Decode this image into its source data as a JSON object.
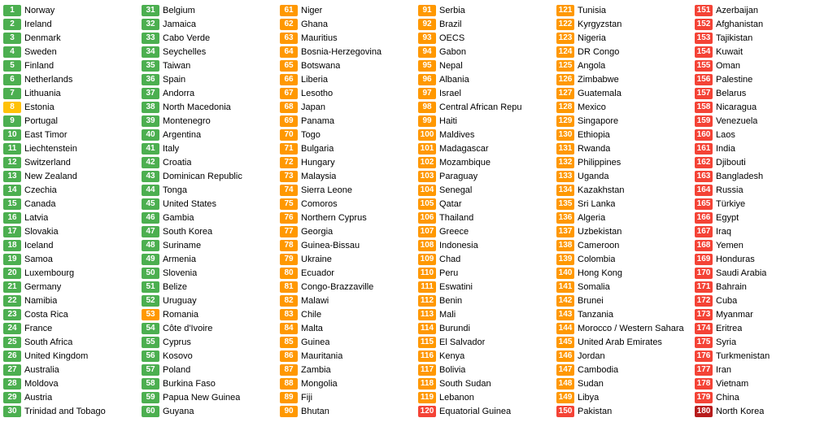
{
  "columns": [
    {
      "id": "col1",
      "entries": [
        {
          "rank": 1,
          "country": "Norway",
          "color": "green"
        },
        {
          "rank": 2,
          "country": "Ireland",
          "color": "green"
        },
        {
          "rank": 3,
          "country": "Denmark",
          "color": "green"
        },
        {
          "rank": 4,
          "country": "Sweden",
          "color": "green"
        },
        {
          "rank": 5,
          "country": "Finland",
          "color": "green"
        },
        {
          "rank": 6,
          "country": "Netherlands",
          "color": "green"
        },
        {
          "rank": 7,
          "country": "Lithuania",
          "color": "green"
        },
        {
          "rank": 8,
          "country": "Estonia",
          "color": "yellow"
        },
        {
          "rank": 9,
          "country": "Portugal",
          "color": "green"
        },
        {
          "rank": 10,
          "country": "East Timor",
          "color": "green"
        },
        {
          "rank": 11,
          "country": "Liechtenstein",
          "color": "green"
        },
        {
          "rank": 12,
          "country": "Switzerland",
          "color": "green"
        },
        {
          "rank": 13,
          "country": "New Zealand",
          "color": "green"
        },
        {
          "rank": 14,
          "country": "Czechia",
          "color": "green"
        },
        {
          "rank": 15,
          "country": "Canada",
          "color": "green"
        },
        {
          "rank": 16,
          "country": "Latvia",
          "color": "green"
        },
        {
          "rank": 17,
          "country": "Slovakia",
          "color": "green"
        },
        {
          "rank": 18,
          "country": "Iceland",
          "color": "green"
        },
        {
          "rank": 19,
          "country": "Samoa",
          "color": "green"
        },
        {
          "rank": 20,
          "country": "Luxembourg",
          "color": "green"
        },
        {
          "rank": 21,
          "country": "Germany",
          "color": "green"
        },
        {
          "rank": 22,
          "country": "Namibia",
          "color": "green"
        },
        {
          "rank": 23,
          "country": "Costa Rica",
          "color": "green"
        },
        {
          "rank": 24,
          "country": "France",
          "color": "green"
        },
        {
          "rank": 25,
          "country": "South Africa",
          "color": "green"
        },
        {
          "rank": 26,
          "country": "United Kingdom",
          "color": "green"
        },
        {
          "rank": 27,
          "country": "Australia",
          "color": "green"
        },
        {
          "rank": 28,
          "country": "Moldova",
          "color": "green"
        },
        {
          "rank": 29,
          "country": "Austria",
          "color": "green"
        },
        {
          "rank": 30,
          "country": "Trinidad and Tobago",
          "color": "green"
        }
      ]
    },
    {
      "id": "col2",
      "entries": [
        {
          "rank": 31,
          "country": "Belgium",
          "color": "green"
        },
        {
          "rank": 32,
          "country": "Jamaica",
          "color": "green"
        },
        {
          "rank": 33,
          "country": "Cabo Verde",
          "color": "green"
        },
        {
          "rank": 34,
          "country": "Seychelles",
          "color": "green"
        },
        {
          "rank": 35,
          "country": "Taiwan",
          "color": "green"
        },
        {
          "rank": 36,
          "country": "Spain",
          "color": "green"
        },
        {
          "rank": 37,
          "country": "Andorra",
          "color": "green"
        },
        {
          "rank": 38,
          "country": "North Macedonia",
          "color": "green"
        },
        {
          "rank": 39,
          "country": "Montenegro",
          "color": "green"
        },
        {
          "rank": 40,
          "country": "Argentina",
          "color": "green"
        },
        {
          "rank": 41,
          "country": "Italy",
          "color": "green"
        },
        {
          "rank": 42,
          "country": "Croatia",
          "color": "green"
        },
        {
          "rank": 43,
          "country": "Dominican Republic",
          "color": "green"
        },
        {
          "rank": 44,
          "country": "Tonga",
          "color": "green"
        },
        {
          "rank": 45,
          "country": "United States",
          "color": "green"
        },
        {
          "rank": 46,
          "country": "Gambia",
          "color": "green"
        },
        {
          "rank": 47,
          "country": "South Korea",
          "color": "green"
        },
        {
          "rank": 48,
          "country": "Suriname",
          "color": "green"
        },
        {
          "rank": 49,
          "country": "Armenia",
          "color": "green"
        },
        {
          "rank": 50,
          "country": "Slovenia",
          "color": "green"
        },
        {
          "rank": 51,
          "country": "Belize",
          "color": "green"
        },
        {
          "rank": 52,
          "country": "Uruguay",
          "color": "green"
        },
        {
          "rank": 53,
          "country": "Romania",
          "color": "orange"
        },
        {
          "rank": 54,
          "country": "Côte d'Ivoire",
          "color": "green"
        },
        {
          "rank": 55,
          "country": "Cyprus",
          "color": "green"
        },
        {
          "rank": 56,
          "country": "Kosovo",
          "color": "green"
        },
        {
          "rank": 57,
          "country": "Poland",
          "color": "green"
        },
        {
          "rank": 58,
          "country": "Burkina Faso",
          "color": "green"
        },
        {
          "rank": 59,
          "country": "Papua New Guinea",
          "color": "green"
        },
        {
          "rank": 60,
          "country": "Guyana",
          "color": "green"
        }
      ]
    },
    {
      "id": "col3",
      "entries": [
        {
          "rank": 61,
          "country": "Niger",
          "color": "orange"
        },
        {
          "rank": 62,
          "country": "Ghana",
          "color": "orange"
        },
        {
          "rank": 63,
          "country": "Mauritius",
          "color": "orange"
        },
        {
          "rank": 64,
          "country": "Bosnia-Herzegovina",
          "color": "orange"
        },
        {
          "rank": 65,
          "country": "Botswana",
          "color": "orange"
        },
        {
          "rank": 66,
          "country": "Liberia",
          "color": "orange"
        },
        {
          "rank": 67,
          "country": "Lesotho",
          "color": "orange"
        },
        {
          "rank": 68,
          "country": "Japan",
          "color": "orange"
        },
        {
          "rank": 69,
          "country": "Panama",
          "color": "orange"
        },
        {
          "rank": 70,
          "country": "Togo",
          "color": "orange"
        },
        {
          "rank": 71,
          "country": "Bulgaria",
          "color": "orange"
        },
        {
          "rank": 72,
          "country": "Hungary",
          "color": "orange"
        },
        {
          "rank": 73,
          "country": "Malaysia",
          "color": "orange"
        },
        {
          "rank": 74,
          "country": "Sierra Leone",
          "color": "orange"
        },
        {
          "rank": 75,
          "country": "Comoros",
          "color": "orange"
        },
        {
          "rank": 76,
          "country": "Northern Cyprus",
          "color": "orange"
        },
        {
          "rank": 77,
          "country": "Georgia",
          "color": "orange"
        },
        {
          "rank": 78,
          "country": "Guinea-Bissau",
          "color": "orange"
        },
        {
          "rank": 79,
          "country": "Ukraine",
          "color": "orange"
        },
        {
          "rank": 80,
          "country": "Ecuador",
          "color": "orange"
        },
        {
          "rank": 81,
          "country": "Congo-Brazzaville",
          "color": "orange"
        },
        {
          "rank": 82,
          "country": "Malawi",
          "color": "orange"
        },
        {
          "rank": 83,
          "country": "Chile",
          "color": "orange"
        },
        {
          "rank": 84,
          "country": "Malta",
          "color": "orange"
        },
        {
          "rank": 85,
          "country": "Guinea",
          "color": "orange"
        },
        {
          "rank": 86,
          "country": "Mauritania",
          "color": "orange"
        },
        {
          "rank": 87,
          "country": "Zambia",
          "color": "orange"
        },
        {
          "rank": 88,
          "country": "Mongolia",
          "color": "orange"
        },
        {
          "rank": 89,
          "country": "Fiji",
          "color": "orange"
        },
        {
          "rank": 90,
          "country": "Bhutan",
          "color": "orange"
        }
      ]
    },
    {
      "id": "col4",
      "entries": [
        {
          "rank": 91,
          "country": "Serbia",
          "color": "orange"
        },
        {
          "rank": 92,
          "country": "Brazil",
          "color": "orange"
        },
        {
          "rank": 93,
          "country": "OECS",
          "color": "orange"
        },
        {
          "rank": 94,
          "country": "Gabon",
          "color": "orange"
        },
        {
          "rank": 95,
          "country": "Nepal",
          "color": "orange"
        },
        {
          "rank": 96,
          "country": "Albania",
          "color": "orange"
        },
        {
          "rank": 97,
          "country": "Israel",
          "color": "orange"
        },
        {
          "rank": 98,
          "country": "Central African Repu",
          "color": "orange"
        },
        {
          "rank": 99,
          "country": "Haiti",
          "color": "orange"
        },
        {
          "rank": 100,
          "country": "Maldives",
          "color": "orange"
        },
        {
          "rank": 101,
          "country": "Madagascar",
          "color": "orange"
        },
        {
          "rank": 102,
          "country": "Mozambique",
          "color": "orange"
        },
        {
          "rank": 103,
          "country": "Paraguay",
          "color": "orange"
        },
        {
          "rank": 104,
          "country": "Senegal",
          "color": "orange"
        },
        {
          "rank": 105,
          "country": "Qatar",
          "color": "orange"
        },
        {
          "rank": 106,
          "country": "Thailand",
          "color": "orange"
        },
        {
          "rank": 107,
          "country": "Greece",
          "color": "orange"
        },
        {
          "rank": 108,
          "country": "Indonesia",
          "color": "orange"
        },
        {
          "rank": 109,
          "country": "Chad",
          "color": "orange"
        },
        {
          "rank": 110,
          "country": "Peru",
          "color": "orange"
        },
        {
          "rank": 111,
          "country": "Eswatini",
          "color": "orange"
        },
        {
          "rank": 112,
          "country": "Benin",
          "color": "orange"
        },
        {
          "rank": 113,
          "country": "Mali",
          "color": "orange"
        },
        {
          "rank": 114,
          "country": "Burundi",
          "color": "orange"
        },
        {
          "rank": 115,
          "country": "El Salvador",
          "color": "orange"
        },
        {
          "rank": 116,
          "country": "Kenya",
          "color": "orange"
        },
        {
          "rank": 117,
          "country": "Bolivia",
          "color": "orange"
        },
        {
          "rank": 118,
          "country": "South Sudan",
          "color": "orange"
        },
        {
          "rank": 119,
          "country": "Lebanon",
          "color": "orange"
        },
        {
          "rank": 120,
          "country": "Equatorial Guinea",
          "color": "red"
        }
      ]
    },
    {
      "id": "col5",
      "entries": [
        {
          "rank": 121,
          "country": "Tunisia",
          "color": "orange"
        },
        {
          "rank": 122,
          "country": "Kyrgyzstan",
          "color": "orange"
        },
        {
          "rank": 123,
          "country": "Nigeria",
          "color": "orange"
        },
        {
          "rank": 124,
          "country": "DR Congo",
          "color": "orange"
        },
        {
          "rank": 125,
          "country": "Angola",
          "color": "orange"
        },
        {
          "rank": 126,
          "country": "Zimbabwe",
          "color": "orange"
        },
        {
          "rank": 127,
          "country": "Guatemala",
          "color": "orange"
        },
        {
          "rank": 128,
          "country": "Mexico",
          "color": "orange"
        },
        {
          "rank": 129,
          "country": "Singapore",
          "color": "orange"
        },
        {
          "rank": 130,
          "country": "Ethiopia",
          "color": "orange"
        },
        {
          "rank": 131,
          "country": "Rwanda",
          "color": "orange"
        },
        {
          "rank": 132,
          "country": "Philippines",
          "color": "orange"
        },
        {
          "rank": 133,
          "country": "Uganda",
          "color": "orange"
        },
        {
          "rank": 134,
          "country": "Kazakhstan",
          "color": "orange"
        },
        {
          "rank": 135,
          "country": "Sri Lanka",
          "color": "orange"
        },
        {
          "rank": 136,
          "country": "Algeria",
          "color": "orange"
        },
        {
          "rank": 137,
          "country": "Uzbekistan",
          "color": "orange"
        },
        {
          "rank": 138,
          "country": "Cameroon",
          "color": "orange"
        },
        {
          "rank": 139,
          "country": "Colombia",
          "color": "orange"
        },
        {
          "rank": 140,
          "country": "Hong Kong",
          "color": "orange"
        },
        {
          "rank": 141,
          "country": "Somalia",
          "color": "orange"
        },
        {
          "rank": 142,
          "country": "Brunei",
          "color": "orange"
        },
        {
          "rank": 143,
          "country": "Tanzania",
          "color": "orange"
        },
        {
          "rank": 144,
          "country": "Morocco / Western Sahara",
          "color": "orange"
        },
        {
          "rank": 145,
          "country": "United Arab Emirates",
          "color": "orange"
        },
        {
          "rank": 146,
          "country": "Jordan",
          "color": "orange"
        },
        {
          "rank": 147,
          "country": "Cambodia",
          "color": "orange"
        },
        {
          "rank": 148,
          "country": "Sudan",
          "color": "orange"
        },
        {
          "rank": 149,
          "country": "Libya",
          "color": "orange"
        },
        {
          "rank": 150,
          "country": "Pakistan",
          "color": "red"
        }
      ]
    },
    {
      "id": "col6",
      "entries": [
        {
          "rank": 151,
          "country": "Azerbaijan",
          "color": "red"
        },
        {
          "rank": 152,
          "country": "Afghanistan",
          "color": "red"
        },
        {
          "rank": 153,
          "country": "Tajikistan",
          "color": "red"
        },
        {
          "rank": 154,
          "country": "Kuwait",
          "color": "red"
        },
        {
          "rank": 155,
          "country": "Oman",
          "color": "red"
        },
        {
          "rank": 156,
          "country": "Palestine",
          "color": "red"
        },
        {
          "rank": 157,
          "country": "Belarus",
          "color": "red"
        },
        {
          "rank": 158,
          "country": "Nicaragua",
          "color": "red"
        },
        {
          "rank": 159,
          "country": "Venezuela",
          "color": "red"
        },
        {
          "rank": 160,
          "country": "Laos",
          "color": "red"
        },
        {
          "rank": 161,
          "country": "India",
          "color": "red"
        },
        {
          "rank": 162,
          "country": "Djibouti",
          "color": "red"
        },
        {
          "rank": 163,
          "country": "Bangladesh",
          "color": "red"
        },
        {
          "rank": 164,
          "country": "Russia",
          "color": "red"
        },
        {
          "rank": 165,
          "country": "Türkiye",
          "color": "red"
        },
        {
          "rank": 166,
          "country": "Egypt",
          "color": "red"
        },
        {
          "rank": 167,
          "country": "Iraq",
          "color": "red"
        },
        {
          "rank": 168,
          "country": "Yemen",
          "color": "red"
        },
        {
          "rank": 169,
          "country": "Honduras",
          "color": "red"
        },
        {
          "rank": 170,
          "country": "Saudi Arabia",
          "color": "red"
        },
        {
          "rank": 171,
          "country": "Bahrain",
          "color": "red"
        },
        {
          "rank": 172,
          "country": "Cuba",
          "color": "red"
        },
        {
          "rank": 173,
          "country": "Myanmar",
          "color": "red"
        },
        {
          "rank": 174,
          "country": "Eritrea",
          "color": "red"
        },
        {
          "rank": 175,
          "country": "Syria",
          "color": "red"
        },
        {
          "rank": 176,
          "country": "Turkmenistan",
          "color": "red"
        },
        {
          "rank": 177,
          "country": "Iran",
          "color": "red"
        },
        {
          "rank": 178,
          "country": "Vietnam",
          "color": "red"
        },
        {
          "rank": 179,
          "country": "China",
          "color": "red"
        },
        {
          "rank": 180,
          "country": "North Korea",
          "color": "dark-red"
        }
      ]
    }
  ]
}
